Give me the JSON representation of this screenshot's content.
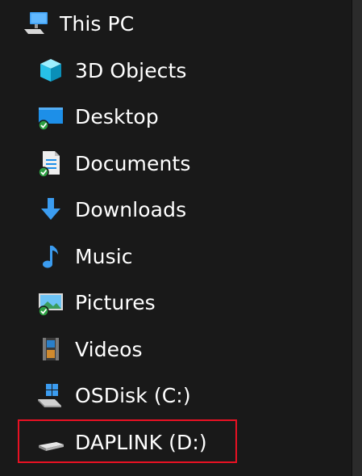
{
  "nav_tree": {
    "root": {
      "label": "This PC",
      "icon": "this-pc-icon"
    },
    "items": [
      {
        "label": "3D Objects",
        "icon": "3d-objects-icon"
      },
      {
        "label": "Desktop",
        "icon": "desktop-icon",
        "sync_status": "synced"
      },
      {
        "label": "Documents",
        "icon": "documents-icon",
        "sync_status": "synced"
      },
      {
        "label": "Downloads",
        "icon": "downloads-icon"
      },
      {
        "label": "Music",
        "icon": "music-icon"
      },
      {
        "label": "Pictures",
        "icon": "pictures-icon",
        "sync_status": "synced"
      },
      {
        "label": "Videos",
        "icon": "videos-icon"
      },
      {
        "label": "OSDisk (C:)",
        "icon": "windows-drive-icon"
      },
      {
        "label": "DAPLINK (D:)",
        "icon": "removable-drive-icon",
        "highlighted": true
      }
    ]
  },
  "colors": {
    "background": "#191919",
    "text": "#ffffff",
    "highlight_border": "#e81123",
    "sync_badge": "#2ea043",
    "folder_blue": "#1e90ff"
  }
}
